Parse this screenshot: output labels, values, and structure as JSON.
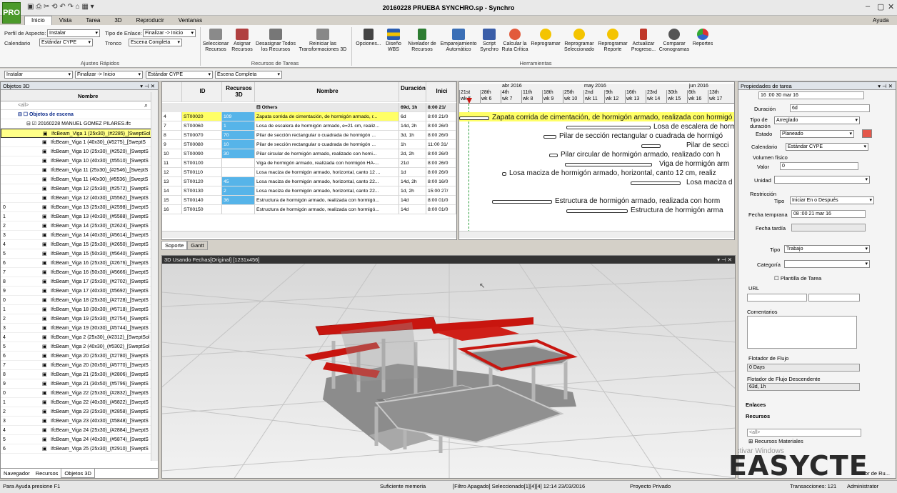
{
  "app": {
    "title": "20160228 PRUEBA SYNCHRO.sp - Synchro",
    "logo": "PRO",
    "help": "Ayuda"
  },
  "menu_tabs": [
    "Inicio",
    "Vista",
    "Tarea",
    "3D",
    "Reproducir",
    "Ventanas"
  ],
  "ribbon": {
    "perfil_label": "Perfil de Aspecto:",
    "perfil_value": "Instalar",
    "calendario_label": "Calendario",
    "calendario_value": "Estándar CYPE",
    "enlace_label": "Tipo de Enlace:",
    "enlace_value": "Finalizar -> Inicio",
    "tronco_label": "Tronco",
    "tronco_value": "Escena Completa",
    "group_ajustes": "Ajustes Rápidos",
    "group_recursos": "Recursos de Tareas",
    "group_herr": "Herramientas",
    "buttons": [
      "Seleccionar Recursos",
      "Asignar Recursos",
      "Desasignar Todos los Recursos",
      "Reiniciar las Transformaciones 3D",
      "Opciones...",
      "Diseño WBS",
      "Nivelador de Recursos",
      "Emparejamiento Automático",
      "Script Synchro",
      "Calcular la Ruta Crítica",
      "Reprogramar",
      "Reprogramar Seleccionado",
      "Reprogramar Reporte",
      "Actualizar Progreso...",
      "Comparar Cronogramas",
      "Reportes"
    ]
  },
  "quickbar": [
    "Instalar",
    "Finalizar -> Inicio",
    "Estándar CYPE",
    "Escena Completa"
  ],
  "objects_panel": {
    "title": "Objetos 3D",
    "col": "Nombre",
    "filter": "<all>",
    "root": "Objetos de escena",
    "file": "20160228 MANUEL GOMEZ PILARES.ifc",
    "items": [
      {
        "n": "",
        "t": "IfcBeam_Viga 1 (25x30)_(#2285)_[SweptSol"
      },
      {
        "n": "",
        "t": "IfcBeam_Viga 1 (40x30)_(#5275)_[SweptS"
      },
      {
        "n": "",
        "t": "IfcBeam_Viga 10 (25x30)_(#2520)_[SweptS"
      },
      {
        "n": "",
        "t": "IfcBeam_Viga 10 (40x30)_(#5510)_[SweptS"
      },
      {
        "n": "",
        "t": "IfcBeam_Viga 11 (25x30)_(#2546)_[SweptS"
      },
      {
        "n": "",
        "t": "IfcBeam_Viga 11 (40x30)_(#5536)_[SweptS"
      },
      {
        "n": "",
        "t": "IfcBeam_Viga 12 (25x30)_(#2572)_[SweptS"
      },
      {
        "n": "",
        "t": "IfcBeam_Viga 12 (40x30)_(#5562)_[SweptS"
      },
      {
        "n": "0",
        "t": "IfcBeam_Viga 13 (25x30)_(#2598)_[SweptS"
      },
      {
        "n": "1",
        "t": "IfcBeam_Viga 13 (40x30)_(#5588)_[SweptS"
      },
      {
        "n": "2",
        "t": "IfcBeam_Viga 14 (25x30)_(#2624)_[SweptS"
      },
      {
        "n": "3",
        "t": "IfcBeam_Viga 14 (40x30)_(#5614)_[SweptS"
      },
      {
        "n": "4",
        "t": "IfcBeam_Viga 15 (25x30)_(#2650)_[SweptS"
      },
      {
        "n": "5",
        "t": "IfcBeam_Viga 15 (50x30)_(#5640)_[SweptS"
      },
      {
        "n": "6",
        "t": "IfcBeam_Viga 16 (25x30)_(#2676)_[SweptS"
      },
      {
        "n": "7",
        "t": "IfcBeam_Viga 16 (50x30)_(#5666)_[SweptS"
      },
      {
        "n": "8",
        "t": "IfcBeam_Viga 17 (25x30)_(#2702)_[SweptS"
      },
      {
        "n": "9",
        "t": "IfcBeam_Viga 17 (40x30)_(#5692)_[SweptS"
      },
      {
        "n": "0",
        "t": "IfcBeam_Viga 18 (25x30)_(#2728)_[SweptS"
      },
      {
        "n": "1",
        "t": "IfcBeam_Viga 18 (30x30)_(#5718)_[SweptS"
      },
      {
        "n": "2",
        "t": "IfcBeam_Viga 19 (25x30)_(#2754)_[SweptS"
      },
      {
        "n": "3",
        "t": "IfcBeam_Viga 19 (30x30)_(#5744)_[SweptS"
      },
      {
        "n": "4",
        "t": "IfcBeam_Viga 2 (25x30)_(#2312)_[SweptSol"
      },
      {
        "n": "5",
        "t": "IfcBeam_Viga 2 (40x30)_(#5302)_[SweptSol"
      },
      {
        "n": "6",
        "t": "IfcBeam_Viga 20 (25x30)_(#2780)_[SweptS"
      },
      {
        "n": "7",
        "t": "IfcBeam_Viga 20 (30x50)_(#5770)_[SweptS"
      },
      {
        "n": "8",
        "t": "IfcBeam_Viga 21 (25x30)_(#2806)_[SweptS"
      },
      {
        "n": "9",
        "t": "IfcBeam_Viga 21 (30x50)_(#5796)_[SweptS"
      },
      {
        "n": "0",
        "t": "IfcBeam_Viga 22 (25x30)_(#2832)_[SweptS"
      },
      {
        "n": "1",
        "t": "IfcBeam_Viga 22 (40x30)_(#5822)_[SweptS"
      },
      {
        "n": "2",
        "t": "IfcBeam_Viga 23 (25x30)_(#2858)_[SweptS"
      },
      {
        "n": "3",
        "t": "IfcBeam_Viga 23 (40x30)_(#5848)_[SweptS"
      },
      {
        "n": "4",
        "t": "IfcBeam_Viga 24 (25x30)_(#2884)_[SweptS"
      },
      {
        "n": "5",
        "t": "IfcBeam_Viga 24 (40x30)_(#5874)_[SweptS"
      },
      {
        "n": "6",
        "t": "IfcBeam_Viga 25 (25x30)_(#2910)_[SweptS"
      }
    ],
    "bottom_tabs": [
      "Navegador",
      "Recursos",
      "Objetos 3D"
    ]
  },
  "task_grid": {
    "headers": [
      "ID",
      "Recursos 3D",
      "Nombre",
      "Duración",
      "Inici"
    ],
    "group": {
      "name": "Others",
      "dur": "69d, 1h",
      "start": "8:00 21/"
    },
    "rows": [
      {
        "n": "4",
        "id": "ST00020",
        "r": "109",
        "name": "Zapata corrida de cimentación, de hormigón armado, r...",
        "dur": "6d",
        "start": "8:00 21/0",
        "hl": true
      },
      {
        "n": "7",
        "id": "ST00060",
        "r": "1",
        "name": "Losa de escalera de hormigón armado, e=21 cm, realiz...",
        "dur": "14d, 2h",
        "start": "8:00 26/0",
        "hl": false
      },
      {
        "n": "8",
        "id": "ST00070",
        "r": "70",
        "name": "Pilar de sección rectangular o cuadrada de hormigón ...",
        "dur": "3d, 1h",
        "start": "8:00 26/0",
        "hl": false
      },
      {
        "n": "9",
        "id": "ST00080",
        "r": "10",
        "name": "Pilar de sección rectangular o cuadrada de hormigón ...",
        "dur": "1h",
        "start": "11:00 31/",
        "hl": false
      },
      {
        "n": "10",
        "id": "ST00090",
        "r": "30",
        "name": "Pilar circular de hormigón armado, realizado con homi...",
        "dur": "2d, 2h",
        "start": "8:00 26/0",
        "hl": false
      },
      {
        "n": "11",
        "id": "ST00100",
        "r": "",
        "name": "Viga de hormigón armado, realizada con hormigón HA-...",
        "dur": "21d",
        "start": "8:00 26/0",
        "hl": false
      },
      {
        "n": "12",
        "id": "ST00110",
        "r": "",
        "name": "Losa maciza de hormigón armado, horizontal, canto 12 ...",
        "dur": "1d",
        "start": "8:00 26/0",
        "hl": false
      },
      {
        "n": "13",
        "id": "ST00120",
        "r": "45",
        "name": "Losa maciza de hormigón armado, horizontal, canto 22...",
        "dur": "14d, 2h",
        "start": "8:00 16/0",
        "hl": false
      },
      {
        "n": "14",
        "id": "ST00130",
        "r": "2",
        "name": "Losa maciza de hormigón armado, horizontal, canto 22...",
        "dur": "1d, 2h",
        "start": "15:00 27/",
        "hl": false
      },
      {
        "n": "15",
        "id": "ST00140",
        "r": "36",
        "name": "Estructura de hormigón armado, realizada con hormigó...",
        "dur": "14d",
        "start": "8:00 01/0",
        "hl": false
      },
      {
        "n": "16",
        "id": "ST00150",
        "r": "",
        "name": "Estructura de hormigón armado, realizada con hormigó...",
        "dur": "14d",
        "start": "8:00 01/0",
        "hl": false
      }
    ],
    "bottom_tabs": [
      "Soporte",
      "Gantt"
    ]
  },
  "gantt": {
    "months": [
      "abr 2016",
      "may 2016",
      "jun 2016"
    ],
    "days": [
      "21st",
      "28th",
      "4th",
      "11th",
      "18th",
      "25th",
      "2nd",
      "9th",
      "16th",
      "23rd",
      "30th",
      "6th",
      "13th"
    ],
    "weeks": [
      "wk 5",
      "wk 6",
      "wk 7",
      "wk 8",
      "wk 9",
      "wk 10",
      "wk 11",
      "wk 12",
      "wk 13",
      "wk 14",
      "wk 15",
      "wk 16",
      "wk 17"
    ],
    "bars": [
      "Zapata corrida de cimentación, de hormigón armado, realizada con hormigó",
      "Losa de escalera de hormigó",
      "Pilar de sección rectangular o cuadrada de hormigó",
      "Pilar de secci",
      "Pilar circular de hormigón armado, realizado con h",
      "Viga de hormigón arm",
      "Losa maciza de hormigón armado, horizontal, canto 12 cm, realiz",
      "Losa maciza d",
      "Estructura de hormigón armado, realizada con horm",
      "Estructura de hormigón arma"
    ]
  },
  "view3d": {
    "title": "3D Usando Fechas[Original] [1231x456]"
  },
  "props": {
    "title": "Propiedades de tarea",
    "top_date": "16 :00 30  mar  16",
    "duracion_label": "Duración",
    "duracion_value": "6d",
    "tipo_dur_label": "Tipo de duración",
    "tipo_dur_value": "Arreglado",
    "estado_label": "Estado",
    "estado_value": "Planeado",
    "calendario_label": "Calendario",
    "calendario_value": "Estándar CYPE",
    "volumen_label": "Volumen físico",
    "valor_label": "Valor",
    "valor_value": "0",
    "unidad_label": "Unidad",
    "restriccion_label": "Restricción",
    "tipo_label": "Tipo",
    "tipo_value": "Iniciar En o Después",
    "fecha_temp_label": "Fecha temprana",
    "fecha_temp_value": "08 :00  21  mar  16",
    "fecha_tardia_label": "Fecha tardía",
    "tipo2_label": "Tipo",
    "tipo2_value": "Trabajo",
    "categoria_label": "Categoría",
    "plantilla_label": "Plantilla de Tarea",
    "url_label": "URL",
    "comentarios_label": "Comentarios",
    "flotador_label": "Flotador de Flujo",
    "flotador_value": "0 Days",
    "flotador_desc_label": "Flotador de Flujo Descendente",
    "flotador_desc_value": "63d, 1h",
    "enlaces_label": "Enlaces",
    "recursos_label": "Recursos",
    "filter": "<all>",
    "recursos_mat": "Recursos Materiales",
    "activar": "Activar Windows",
    "editor": "Editor de Ru...",
    "transacciones": "Transacciones: 121",
    "admin": "Administrator"
  },
  "status": {
    "ayuda": "Para Ayuda presione F1",
    "memoria": "Suficiente memoria",
    "filtro": "[Filtro Apagado] Seleccionado[1][4][4]  12:14 23/03/2016",
    "proyecto": "Proyecto Privado"
  },
  "watermark": "EASYCTE",
  "colors": {
    "red": "#c8150f",
    "highlight": "#ffff66",
    "blue_cell": "#56b4e9",
    "green": "#4c9a2a"
  }
}
